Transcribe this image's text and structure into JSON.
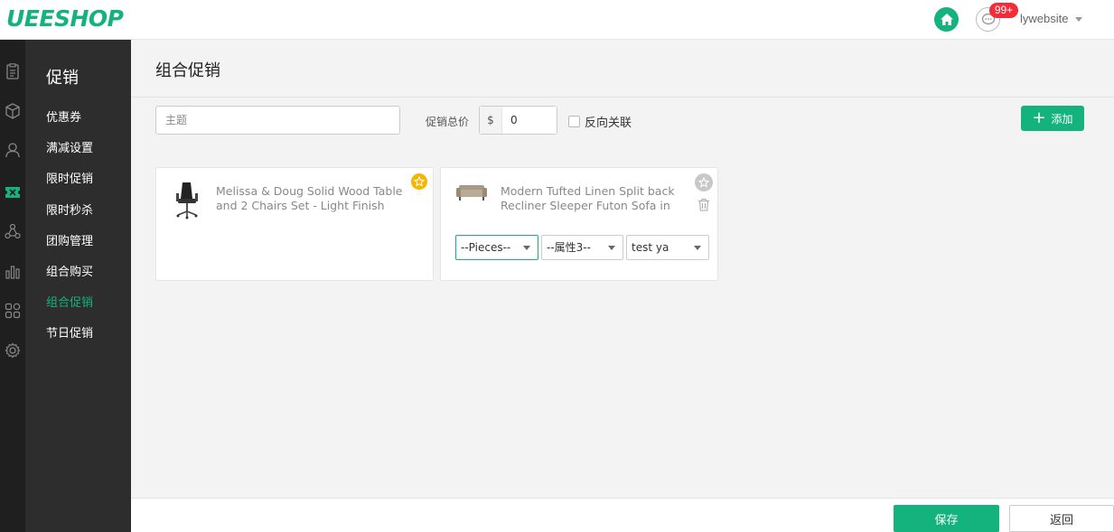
{
  "header": {
    "logo": "UEESHOP",
    "notification_count": "99+",
    "username": "lywebsite"
  },
  "rail": {
    "icons": [
      "orders-icon",
      "products-icon",
      "users-icon",
      "promotion-icon",
      "distribution-icon",
      "stats-icon",
      "apps-icon",
      "settings-icon"
    ],
    "active": "promotion-icon"
  },
  "subnav": {
    "title": "促销",
    "items": [
      {
        "label": "优惠券"
      },
      {
        "label": "满减设置"
      },
      {
        "label": "限时促销"
      },
      {
        "label": "限时秒杀"
      },
      {
        "label": "团购管理"
      },
      {
        "label": "组合购买"
      },
      {
        "label": "组合促销"
      },
      {
        "label": "节日促销"
      }
    ],
    "active_index": 6
  },
  "main": {
    "title": "组合促销",
    "subject_placeholder": "主题",
    "subject_value": "",
    "total_label": "促销总价",
    "currency": "$",
    "total_value": "0",
    "reverse_label": "反向关联",
    "reverse_checked": false,
    "add_label": "添加"
  },
  "products": [
    {
      "name": "Melissa & Doug Solid Wood Table and 2 Chairs Set - Light Finish",
      "thumb": "office-chair",
      "primary": true
    },
    {
      "name": "Modern Tufted Linen Split back Recliner Sleeper Futon Sofa in",
      "thumb": "sofa",
      "primary": false,
      "selects": [
        "--Pieces--",
        "--属性3--",
        "test ya"
      ]
    }
  ],
  "footer": {
    "save_label": "保存",
    "back_label": "返回"
  },
  "colors": {
    "accent": "#14b37d",
    "badge": "#f52b3a",
    "star": "#f7b500"
  }
}
